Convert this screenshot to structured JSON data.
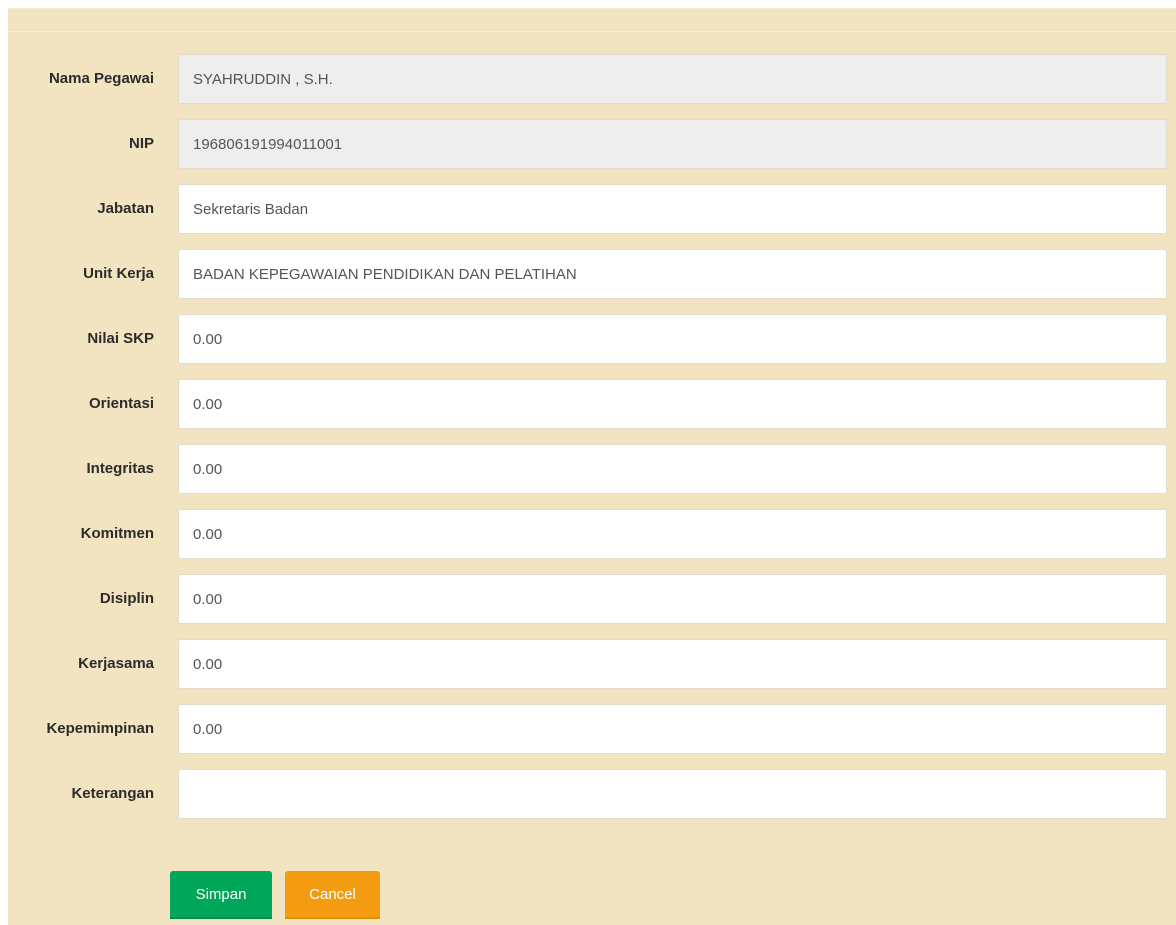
{
  "form": {
    "fields": [
      {
        "label": "Nama Pegawai",
        "value": "SYAHRUDDIN , S.H.",
        "readonly": true
      },
      {
        "label": "NIP",
        "value": "196806191994011001",
        "readonly": true
      },
      {
        "label": "Jabatan",
        "value": "Sekretaris Badan",
        "readonly": false
      },
      {
        "label": "Unit Kerja",
        "value": "BADAN KEPEGAWAIAN PENDIDIKAN DAN PELATIHAN",
        "readonly": false
      },
      {
        "label": "Nilai SKP",
        "value": "0.00",
        "readonly": false
      },
      {
        "label": "Orientasi",
        "value": "0.00",
        "readonly": false
      },
      {
        "label": "Integritas",
        "value": "0.00",
        "readonly": false
      },
      {
        "label": "Komitmen",
        "value": "0.00",
        "readonly": false
      },
      {
        "label": "Disiplin",
        "value": "0.00",
        "readonly": false
      },
      {
        "label": "Kerjasama",
        "value": "0.00",
        "readonly": false
      },
      {
        "label": "Kepemimpinan",
        "value": "0.00",
        "readonly": false
      },
      {
        "label": "Keterangan",
        "value": "",
        "readonly": false
      }
    ]
  },
  "actions": {
    "save_label": "Simpan",
    "cancel_label": "Cancel"
  },
  "colors": {
    "panel_background": "#f2e4c1",
    "readonly_background": "#eeeeee",
    "save_button": "#00a65a",
    "cancel_button": "#f39c12"
  }
}
